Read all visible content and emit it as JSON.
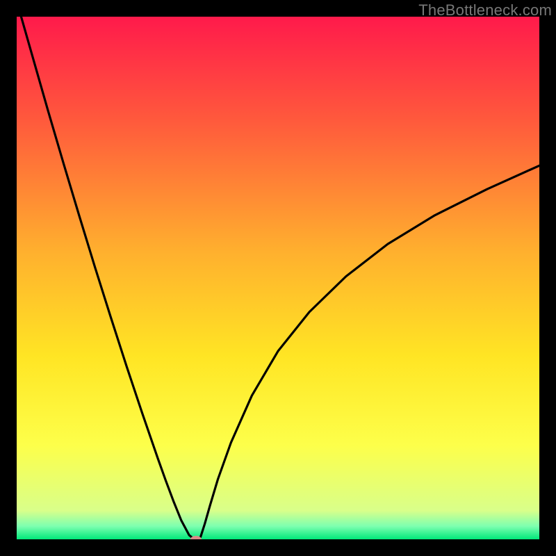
{
  "watermark": "TheBottleneck.com",
  "chart_data": {
    "type": "line",
    "title": "",
    "xlabel": "",
    "ylabel": "",
    "xlim": [
      0,
      100
    ],
    "ylim": [
      0,
      100
    ],
    "grid": false,
    "legend": false,
    "gradient_stops": [
      {
        "offset": 0.0,
        "color": "#ff1a4b"
      },
      {
        "offset": 0.2,
        "color": "#ff5a3c"
      },
      {
        "offset": 0.45,
        "color": "#ffb02e"
      },
      {
        "offset": 0.65,
        "color": "#ffe524"
      },
      {
        "offset": 0.82,
        "color": "#fdff4a"
      },
      {
        "offset": 0.945,
        "color": "#d9ff8a"
      },
      {
        "offset": 0.975,
        "color": "#7dffb0"
      },
      {
        "offset": 1.0,
        "color": "#00e87a"
      }
    ],
    "series": [
      {
        "name": "bottleneck-curve",
        "x": [
          0.0,
          3.0,
          6.0,
          9.0,
          12.0,
          15.0,
          18.0,
          21.0,
          24.0,
          27.0,
          28.5,
          30.0,
          31.5,
          33.0,
          34.0,
          34.8,
          35.2,
          36.0,
          37.0,
          38.5,
          41.0,
          45.0,
          50.0,
          56.0,
          63.0,
          71.0,
          80.0,
          90.0,
          100.0
        ],
        "values": [
          103.0,
          92.5,
          82.0,
          71.8,
          61.8,
          52.0,
          42.5,
          33.2,
          24.2,
          15.5,
          11.3,
          7.3,
          3.6,
          0.8,
          0.0,
          0.0,
          0.5,
          3.0,
          6.5,
          11.5,
          18.5,
          27.5,
          36.0,
          43.5,
          50.3,
          56.5,
          62.0,
          67.0,
          71.5
        ]
      }
    ],
    "marker": {
      "x": 34.3,
      "y": 0.0,
      "rx": 8,
      "ry": 5,
      "color": "#d98b88"
    }
  }
}
